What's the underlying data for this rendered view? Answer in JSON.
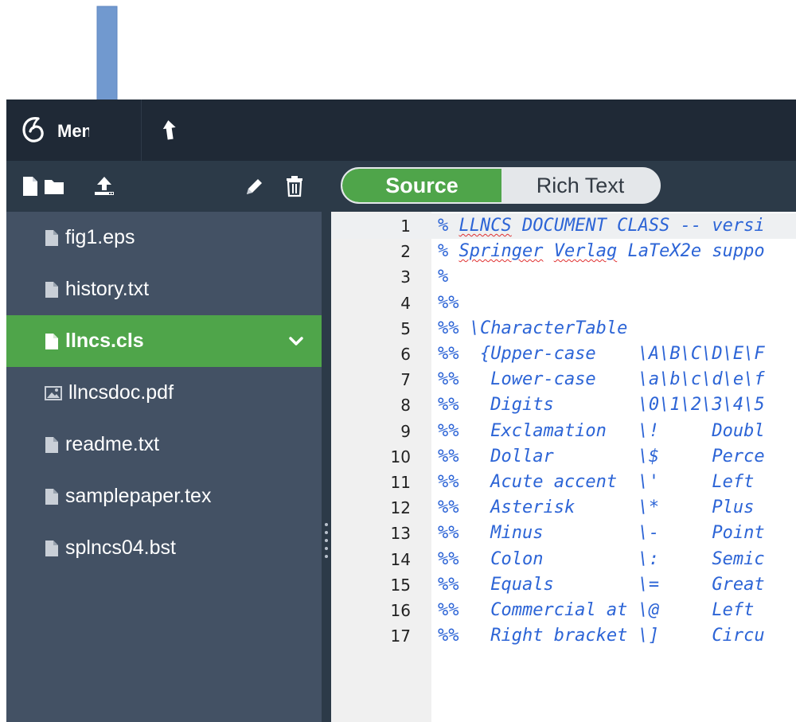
{
  "header": {
    "menu_label": "Menu"
  },
  "sidebar": {
    "toolbar_icons": [
      "new-file-icon",
      "new-folder-icon",
      "upload-icon",
      "rename-icon",
      "delete-icon"
    ],
    "files": [
      {
        "name": "fig1.eps",
        "icon": "file-icon",
        "active": false
      },
      {
        "name": "history.txt",
        "icon": "file-icon",
        "active": false
      },
      {
        "name": "llncs.cls",
        "icon": "file-icon",
        "active": true
      },
      {
        "name": "llncsdoc.pdf",
        "icon": "image-icon",
        "active": false
      },
      {
        "name": "readme.txt",
        "icon": "file-icon",
        "active": false
      },
      {
        "name": "samplepaper.tex",
        "icon": "file-icon",
        "active": false
      },
      {
        "name": "splncs04.bst",
        "icon": "file-icon",
        "active": false
      }
    ]
  },
  "editor": {
    "mode_source": "Source",
    "mode_rich": "Rich Text",
    "lines": [
      {
        "n": "1",
        "text": "% LLNCS DOCUMENT CLASS -- versi"
      },
      {
        "n": "2",
        "text": "% Springer Verlag LaTeX2e suppo"
      },
      {
        "n": "3",
        "text": "%"
      },
      {
        "n": "4",
        "text": "%%"
      },
      {
        "n": "5",
        "text": "%% \\CharacterTable"
      },
      {
        "n": "6",
        "text": "%%  {Upper-case    \\A\\B\\C\\D\\E\\F"
      },
      {
        "n": "7",
        "text": "%%   Lower-case    \\a\\b\\c\\d\\e\\f"
      },
      {
        "n": "8",
        "text": "%%   Digits        \\0\\1\\2\\3\\4\\5"
      },
      {
        "n": "9",
        "text": "%%   Exclamation   \\!     Doubl"
      },
      {
        "n": "10",
        "text": "%%   Dollar        \\$     Perce"
      },
      {
        "n": "11",
        "text": "%%   Acute accent  \\'     Left "
      },
      {
        "n": "12",
        "text": "%%   Asterisk      \\*     Plus "
      },
      {
        "n": "13",
        "text": "%%   Minus         \\-     Point"
      },
      {
        "n": "14",
        "text": "%%   Colon         \\:     Semic"
      },
      {
        "n": "15",
        "text": "%%   Equals        \\=     Great"
      },
      {
        "n": "16",
        "text": "%%   Commercial at \\@     Left "
      },
      {
        "n": "17",
        "text": "%%   Right bracket \\]     Circu"
      }
    ]
  },
  "colors": {
    "accent_green": "#4fa54a",
    "sidebar_bg": "#435164",
    "header_bg": "#1f2936",
    "code_blue": "#2c64d6",
    "arrow_blue": "#7199cf"
  }
}
